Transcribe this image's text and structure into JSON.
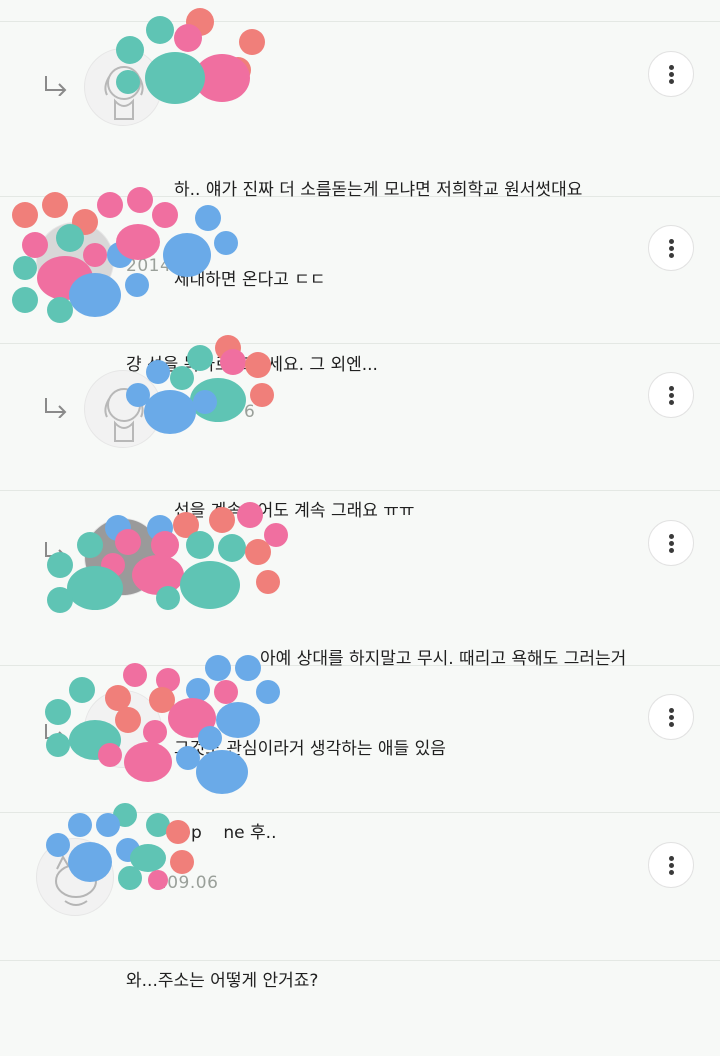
{
  "colors": {
    "background": "#f7f9f7",
    "divider": "#e4e8e4",
    "meta_text": "#9aa09a",
    "sticker_teal": "#5fc4b4",
    "sticker_pink": "#f06fa0",
    "sticker_blue": "#6aaae8",
    "sticker_salmon": "#f07f7a"
  },
  "comments": [
    {
      "is_reply": true,
      "meta": "20 6",
      "lines": [
        "하.. 얘가 진짜 더 소름돋는게 모냐면 저희학교 원서썻대요",
        "제대하면 온다고 ㄷㄷ"
      ],
      "more_icon": "more-vertical-icon"
    },
    {
      "is_reply": false,
      "meta": "2014",
      "lines": [
        "걍 선을 똑바로 그으세요. 그 외엔..."
      ],
      "more_icon": "more-vertical-icon"
    },
    {
      "is_reply": true,
      "meta": "6",
      "lines": [
        "선을 계속그어도 계속 그래요 ㅠㅠ"
      ],
      "more_icon": "more-vertical-icon"
    },
    {
      "is_reply": true,
      "meta": "",
      "lines": [
        "아예 상대를 하지말고 무시. 때리고 욕해도 그러는거",
        "그것도 관심이라거 생각하는 애들 있음"
      ],
      "more_icon": "more-vertical-icon"
    },
    {
      "is_reply": true,
      "meta": "",
      "lines": [
        "@p    ne 후.."
      ],
      "more_icon": "more-vertical-icon"
    },
    {
      "is_reply": false,
      "meta": "1.09.06",
      "lines": [
        "와...주소는 어떻게 안거죠?"
      ],
      "more_icon": "more-vertical-icon"
    }
  ]
}
